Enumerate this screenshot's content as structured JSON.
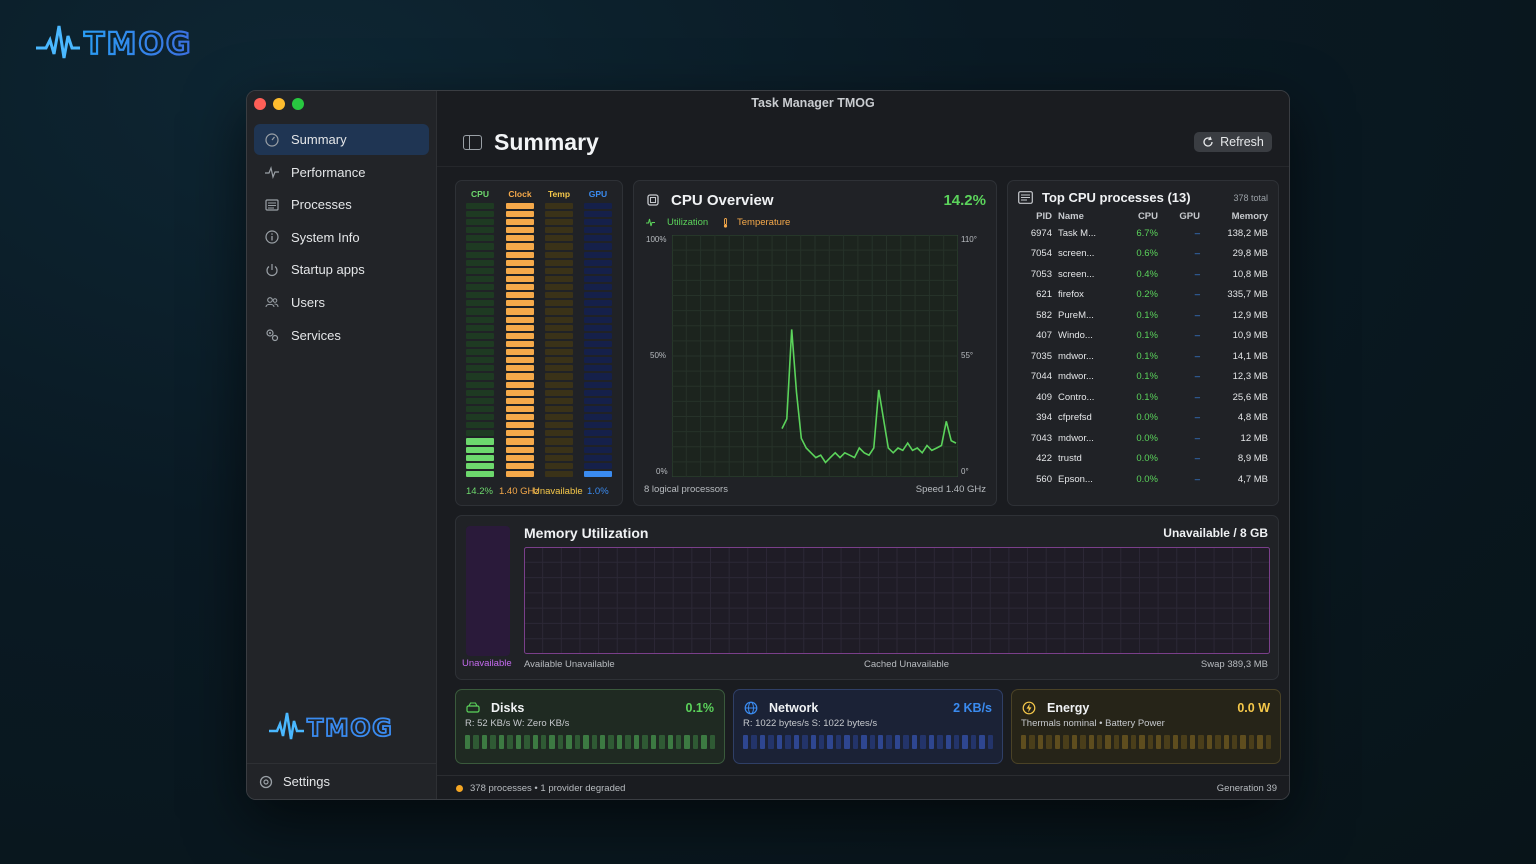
{
  "brand": {
    "logo_text": "TMOG"
  },
  "window": {
    "title": "Task Manager TMOG"
  },
  "sidebar": {
    "items": [
      {
        "label": "Summary",
        "icon": "gauge-icon",
        "active": true
      },
      {
        "label": "Performance",
        "icon": "pulse-icon"
      },
      {
        "label": "Processes",
        "icon": "list-icon"
      },
      {
        "label": "System Info",
        "icon": "info-icon"
      },
      {
        "label": "Startup apps",
        "icon": "power-icon"
      },
      {
        "label": "Users",
        "icon": "users-icon"
      },
      {
        "label": "Services",
        "icon": "gears-icon"
      }
    ],
    "settings_label": "Settings"
  },
  "header": {
    "title": "Summary",
    "refresh_label": "Refresh"
  },
  "mini_bars": {
    "columns": [
      {
        "label": "CPU",
        "value": "14.2%",
        "level": 0.142,
        "color": "#6dd86d",
        "dim": "#1e3a22",
        "label_color": "#6dd86d"
      },
      {
        "label": "Clock",
        "value": "1.40 GHz",
        "level": 1.0,
        "color": "#f5a94a",
        "dim": "#4a3216",
        "label_color": "#f5a94a"
      },
      {
        "label": "Temp",
        "value": "Unavailable",
        "level": 0.0,
        "color": "#f5c84a",
        "dim": "#3a3218",
        "label_color": "#f5c84a"
      },
      {
        "label": "GPU",
        "value": "1.0%",
        "level": 0.01,
        "color": "#3a8bf0",
        "dim": "#15204a",
        "label_color": "#3a8bf0"
      }
    ]
  },
  "cpu_overview": {
    "title": "CPU Overview",
    "value": "14.2%",
    "legend_utilization": "Utilization",
    "legend_temperature": "Temperature",
    "left_axis": [
      "100%",
      "50%",
      "0%"
    ],
    "right_axis": [
      "110°",
      "55°",
      "0°"
    ],
    "processors": "8 logical processors",
    "speed": "Speed 1.40 GHz",
    "line_color": "#5bd35b"
  },
  "chart_data": {
    "type": "line",
    "title": "CPU Overview",
    "ylim": [
      0,
      100
    ],
    "series": [
      {
        "name": "Utilization",
        "values": [
          20,
          24,
          61,
          35,
          16,
          12,
          10,
          8,
          9,
          6,
          8,
          10,
          8,
          10,
          9,
          8,
          12,
          10,
          9,
          12,
          36,
          24,
          12,
          10,
          12,
          11,
          14,
          11,
          12,
          10,
          13,
          11,
          12,
          13,
          23,
          15,
          14
        ]
      }
    ]
  },
  "top_processes": {
    "title": "Top CPU processes (13)",
    "total": "378 total",
    "columns": [
      "PID",
      "Name",
      "CPU",
      "GPU",
      "Memory"
    ],
    "rows": [
      [
        "6974",
        "Task M...",
        "6.7%",
        "–",
        "138,2 MB"
      ],
      [
        "7054",
        "screen...",
        "0.6%",
        "–",
        "29,8 MB"
      ],
      [
        "7053",
        "screen...",
        "0.4%",
        "–",
        "10,8 MB"
      ],
      [
        "621",
        "firefox",
        "0.2%",
        "–",
        "335,7 MB"
      ],
      [
        "582",
        "PureM...",
        "0.1%",
        "–",
        "12,9 MB"
      ],
      [
        "407",
        "Windo...",
        "0.1%",
        "–",
        "10,9 MB"
      ],
      [
        "7035",
        "mdwor...",
        "0.1%",
        "–",
        "14,1 MB"
      ],
      [
        "7044",
        "mdwor...",
        "0.1%",
        "–",
        "12,3 MB"
      ],
      [
        "409",
        "Contro...",
        "0.1%",
        "–",
        "25,6 MB"
      ],
      [
        "394",
        "cfprefsd",
        "0.0%",
        "–",
        "4,8 MB"
      ],
      [
        "7043",
        "mdwor...",
        "0.0%",
        "–",
        "12 MB"
      ],
      [
        "422",
        "trustd",
        "0.0%",
        "–",
        "8,9 MB"
      ],
      [
        "560",
        "Epson...",
        "0.0%",
        "–",
        "4,7 MB"
      ]
    ]
  },
  "memory": {
    "title": "Memory Utilization",
    "value": "Unavailable / 8 GB",
    "bar_label": "Unavailable",
    "available": "Available Unavailable",
    "cached": "Cached Unavailable",
    "swap": "Swap 389,3 MB"
  },
  "cards": {
    "disks": {
      "title": "Disks",
      "value": "0.1%",
      "sub": "R: 52 KB/s  W: Zero KB/s",
      "color": "#5bd35b"
    },
    "network": {
      "title": "Network",
      "value": "2 KB/s",
      "sub": "R: 1022 bytes/s  S: 1022 bytes/s",
      "color": "#3a8bf0"
    },
    "energy": {
      "title": "Energy",
      "value": "0.0 W",
      "sub": "Thermals nominal • Battery Power",
      "color": "#f5c84a"
    }
  },
  "status": {
    "left": "378 processes • 1 provider degraded",
    "right": "Generation 39"
  }
}
